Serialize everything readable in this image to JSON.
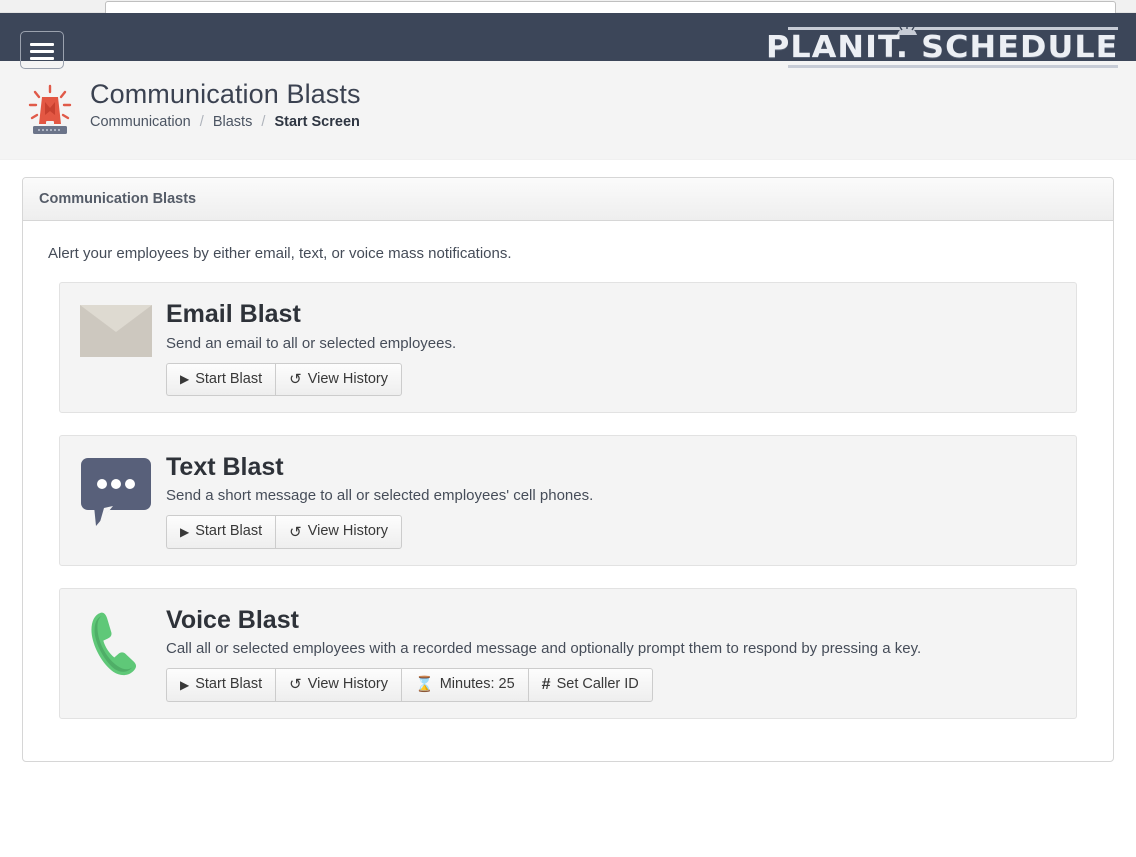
{
  "topbar": {
    "search_value": "",
    "search_placeholder": ""
  },
  "navbar": {
    "menu_icon": "hamburger-icon",
    "brand_name": "PLANIT. SCHEDULE",
    "brand_part1": "PLANIT.",
    "brand_part2": "SCHEDULE",
    "background_color": "#3c4659"
  },
  "page_header": {
    "icon": "siren-icon",
    "title": "Communication Blasts",
    "breadcrumb": [
      {
        "label": "Communication",
        "active": false
      },
      {
        "label": "Blasts",
        "active": false
      },
      {
        "label": "Start Screen",
        "active": true
      }
    ],
    "separator": "/"
  },
  "panel": {
    "heading": "Communication Blasts",
    "intro": "Alert your employees by either email, text, or voice mass notifications."
  },
  "blasts": [
    {
      "id": "email",
      "icon": "envelope-icon",
      "icon_color": "#dedad1",
      "title": "Email Blast",
      "description": "Send an email to all or selected employees.",
      "buttons": [
        {
          "icon": "play-icon",
          "glyph": "▶",
          "label": "Start Blast"
        },
        {
          "icon": "history-icon",
          "glyph": "↺",
          "label": "View History"
        }
      ]
    },
    {
      "id": "text",
      "icon": "speech-bubble-icon",
      "icon_color": "#58607a",
      "title": "Text Blast",
      "description": "Send a short message to all or selected employees' cell phones.",
      "buttons": [
        {
          "icon": "play-icon",
          "glyph": "▶",
          "label": "Start Blast"
        },
        {
          "icon": "history-icon",
          "glyph": "↺",
          "label": "View History"
        }
      ]
    },
    {
      "id": "voice",
      "icon": "phone-icon",
      "icon_color": "#5fc878",
      "title": "Voice Blast",
      "description": "Call all or selected employees with a recorded message and optionally prompt them to respond by pressing a key.",
      "buttons": [
        {
          "icon": "play-icon",
          "glyph": "▶",
          "label": "Start Blast"
        },
        {
          "icon": "history-icon",
          "glyph": "↺",
          "label": "View History"
        },
        {
          "icon": "hourglass-icon",
          "glyph": "⌛",
          "label": "Minutes: 25"
        },
        {
          "icon": "hash-icon",
          "glyph": "#",
          "label": "Set Caller ID"
        }
      ]
    }
  ]
}
